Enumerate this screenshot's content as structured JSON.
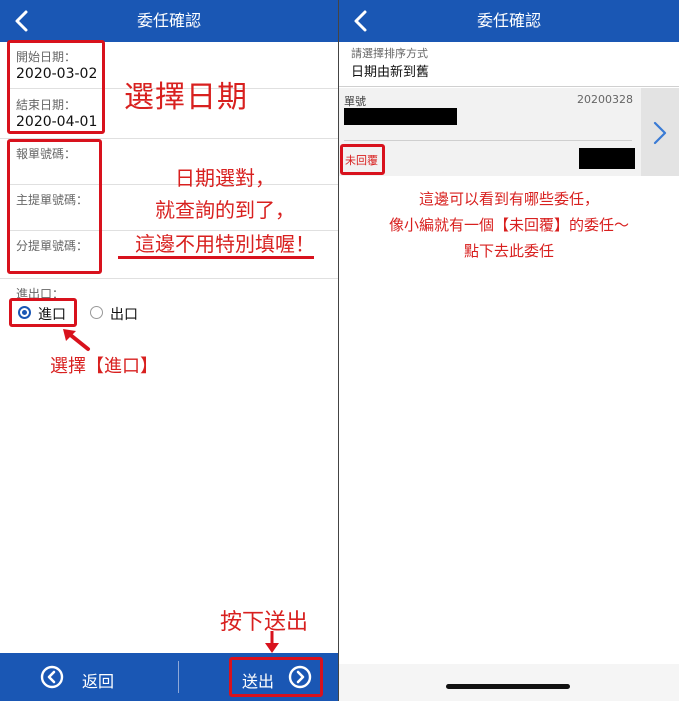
{
  "left": {
    "header": {
      "title": "委任確認"
    },
    "start_date": {
      "label": "開始日期：",
      "value": "2020-03-02"
    },
    "end_date": {
      "label": "結束日期：",
      "value": "2020-04-01"
    },
    "declaration_no": {
      "label": "報單號碼：",
      "value": ""
    },
    "master_bill_no": {
      "label": "主提單號碼：",
      "value": ""
    },
    "sub_bill_no": {
      "label": "分提單號碼：",
      "value": ""
    },
    "io": {
      "label": "進出口：",
      "options": [
        "進口",
        "出口"
      ],
      "selected": "進口"
    },
    "footer": {
      "back_label": "返回",
      "submit_label": "送出"
    },
    "annotations": {
      "select_date": "選擇日期",
      "note_line1": "日期選對，",
      "note_line2": "就查詢的到了，",
      "note_line3": "這邊不用特別填喔！",
      "select_import": "選擇【進口】",
      "press_submit": "按下送出"
    }
  },
  "right": {
    "header": {
      "title": "委任確認"
    },
    "sort": {
      "label": "請選擇排序方式",
      "value": "日期由新到舊"
    },
    "record": {
      "label": "單號",
      "date": "20200328",
      "status": "未回覆"
    },
    "annotations": {
      "line1": "這邊可以看到有哪些委任，",
      "line2": "像小編就有一個【未回覆】的委任～",
      "line3": "點下去此委任"
    }
  },
  "colors": {
    "header_blue": "#1a57b4",
    "annotation_red": "#d8121d"
  }
}
